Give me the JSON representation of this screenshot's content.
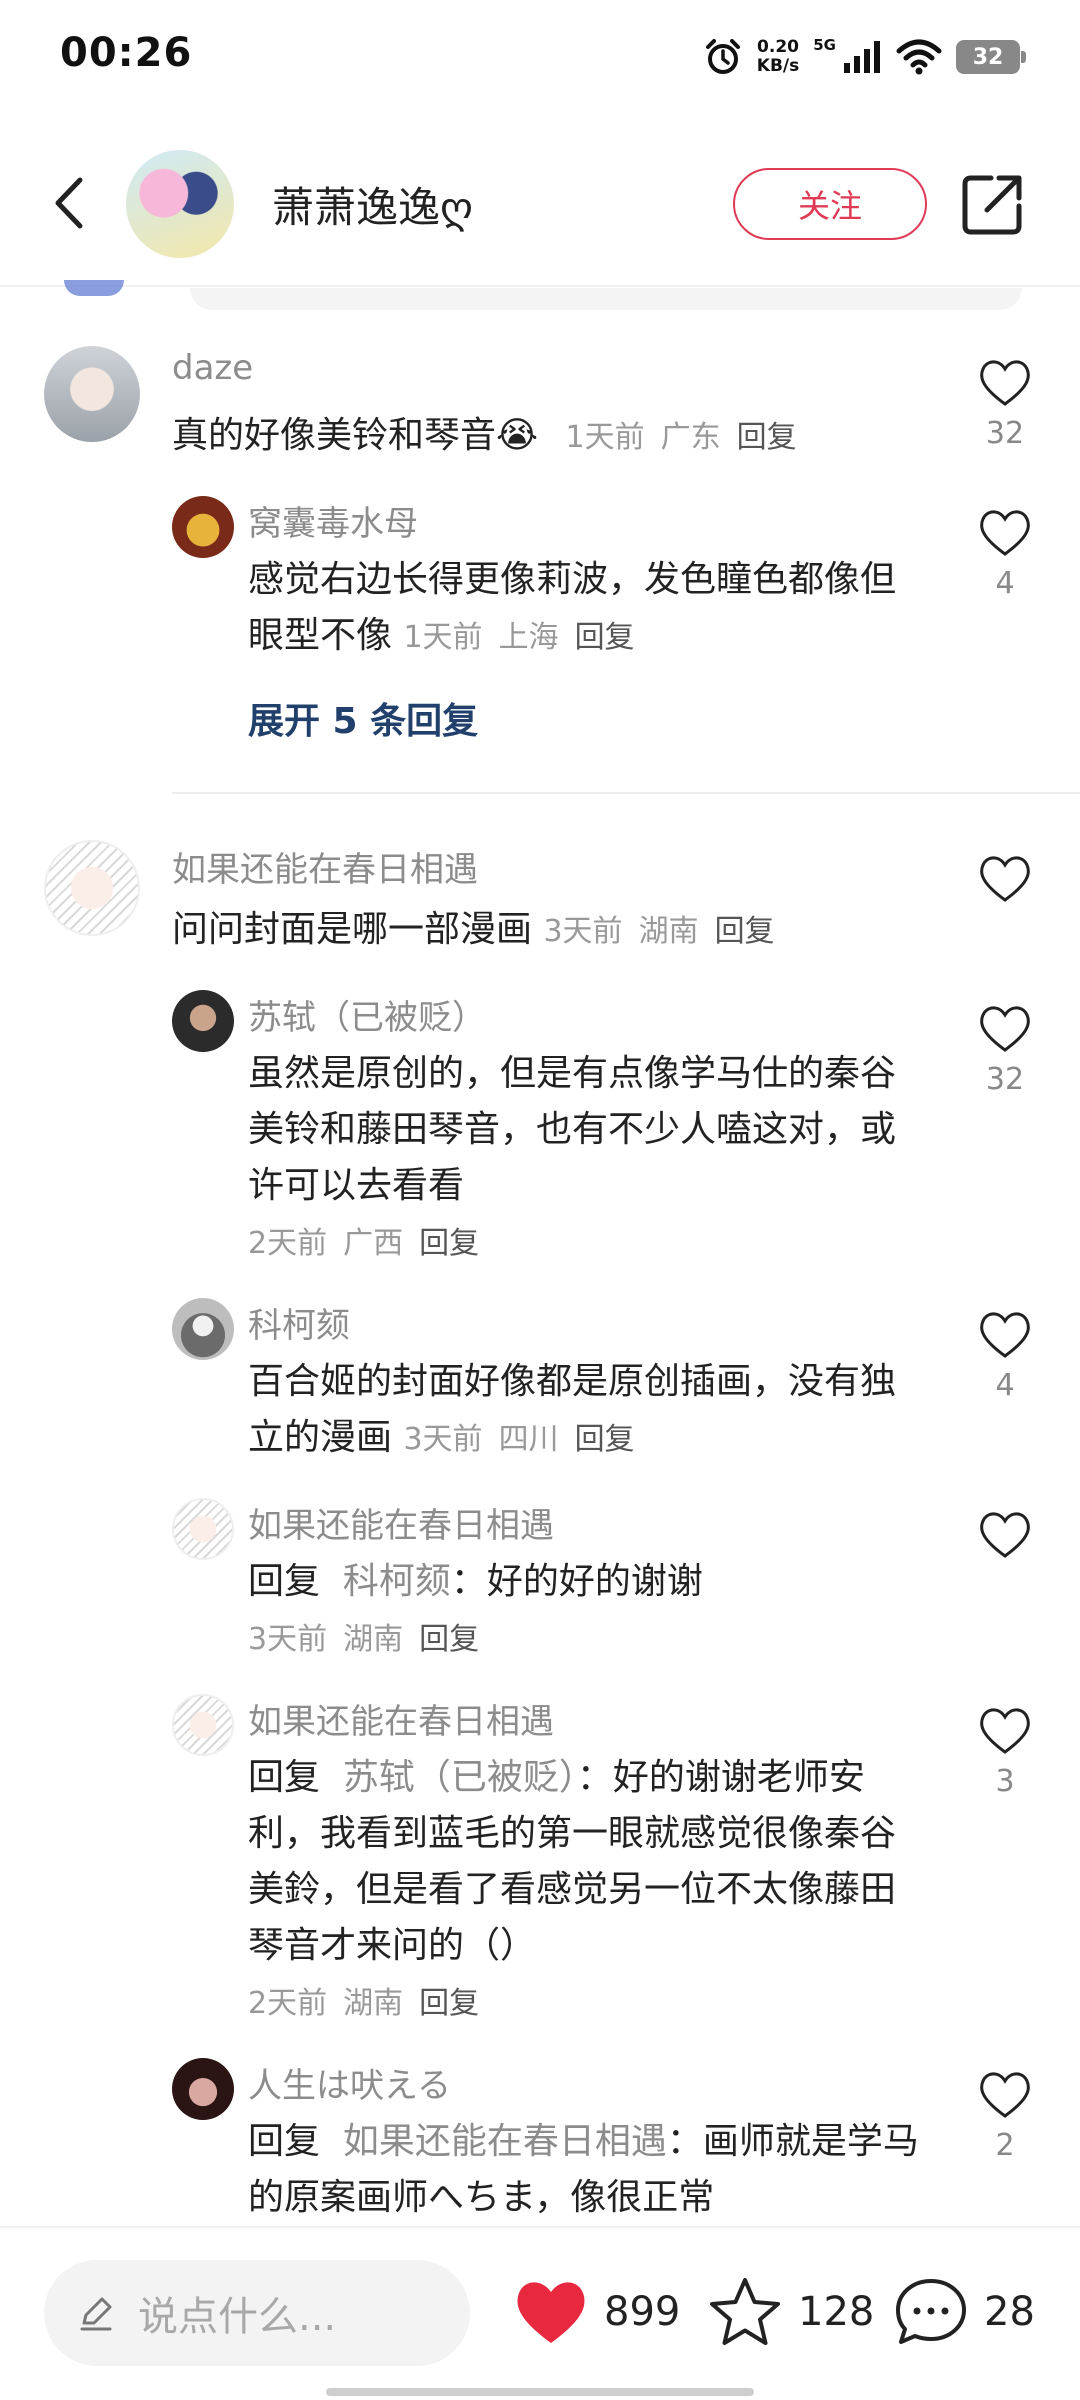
{
  "status_bar": {
    "time": "00:26",
    "net_speed": "0.20",
    "net_unit": "KB/s",
    "network_type": "5G",
    "battery": "32"
  },
  "header": {
    "back_icon": "chevron-left-icon",
    "user_name": "萧萧逸逸ღ",
    "follow_label": "关注",
    "share_icon": "share-external-icon",
    "accent_color": "#e13a55"
  },
  "threads": [
    {
      "name": "daze",
      "text": "真的好像美铃和琴音",
      "emoji": "😭",
      "time": "1天前",
      "location": "广东",
      "reply_label": "回复",
      "likes": "32",
      "replies": [
        {
          "name": "窝囊毒水母",
          "text": "感觉右边长得更像莉波，发色瞳色都像但眼型不像",
          "time": "1天前",
          "location": "上海",
          "reply_label": "回复",
          "likes": "4"
        }
      ],
      "expand_label": "展开 5 条回复"
    },
    {
      "name": "如果还能在春日相遇",
      "text": "问问封面是哪一部漫画",
      "time": "3天前",
      "location": "湖南",
      "reply_label": "回复",
      "likes": "",
      "replies": [
        {
          "name": "苏轼（已被贬）",
          "text": "虽然是原创的，但是有点像学马仕的秦谷美铃和藤田琴音，也有不少人嗑这对，或许可以去看看",
          "time": "2天前",
          "location": "广西",
          "reply_label": "回复",
          "likes": "32"
        },
        {
          "name": "科柯颏",
          "text": "百合姬的封面好像都是原创插画，没有独立的漫画",
          "time": "3天前",
          "location": "四川",
          "reply_label": "回复",
          "likes": "4"
        },
        {
          "name": "如果还能在春日相遇",
          "prefix": "回复",
          "target": "科柯颏",
          "text": "：好的好的谢谢",
          "time": "3天前",
          "location": "湖南",
          "reply_label": "回复",
          "likes": ""
        },
        {
          "name": "如果还能在春日相遇",
          "prefix": "回复",
          "target": "苏轼（已被贬）",
          "text": "：好的谢谢老师安利，我看到蓝毛的第一眼就感觉很像秦谷美鈴，但是看了看感觉另一位不太像藤田琴音才来问的（）",
          "time": "2天前",
          "location": "湖南",
          "reply_label": "回复",
          "likes": "3"
        },
        {
          "name": "人生は吠える",
          "prefix": "回复",
          "target": "如果还能在春日相遇",
          "text": "：画师就是学马的原案画师へちま，像很正常",
          "likes": "2"
        }
      ]
    }
  ],
  "bottom_bar": {
    "input_placeholder": "说点什么...",
    "likes": "899",
    "favorites": "128",
    "comments": "28",
    "like_color": "#e8283f"
  }
}
